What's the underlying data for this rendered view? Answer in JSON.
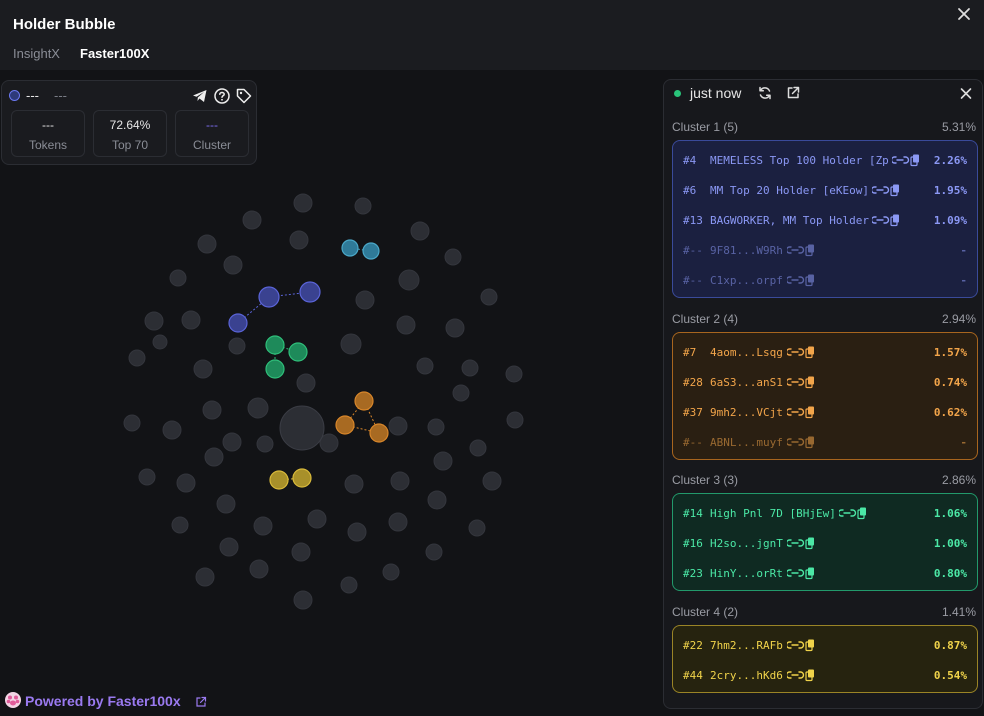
{
  "header": {
    "title": "Holder Bubble",
    "tabs": [
      {
        "label": "InsightX"
      },
      {
        "label": "Faster100X"
      }
    ]
  },
  "info_card": {
    "name": "---",
    "address": "---",
    "stats": [
      {
        "value": "---",
        "label": "Tokens"
      },
      {
        "value": "72.64%",
        "label": "Top 70"
      },
      {
        "value": "---",
        "label": "Cluster"
      }
    ],
    "icons": [
      "telegram-icon",
      "help-icon",
      "tag-icon"
    ]
  },
  "panel": {
    "updated": "just now",
    "icons": [
      "refresh-icon",
      "external-link-icon",
      "close-icon"
    ],
    "clusters": [
      {
        "name": "Cluster 1 (5)",
        "pct": "5.31%",
        "color": "#3a4a9a",
        "rows": [
          {
            "rank": "#4",
            "label": "MEMELESS Top 100 Holder [Zp",
            "value": "2.26%"
          },
          {
            "rank": "#6",
            "label": "MM Top 20 Holder [eKEow]",
            "value": "1.95%"
          },
          {
            "rank": "#13",
            "label": "BAGWORKER, MM Top Holder",
            "value": "1.09%"
          },
          {
            "rank": "#--",
            "label": "9F81...W9Rh",
            "value": "-"
          },
          {
            "rank": "#--",
            "label": "C1xp...orpf",
            "value": "-"
          }
        ]
      },
      {
        "name": "Cluster 2 (4)",
        "pct": "2.94%",
        "color": "#a8651e",
        "rows": [
          {
            "rank": "#7",
            "label": "4aom...Lsqg",
            "value": "1.57%"
          },
          {
            "rank": "#28",
            "label": "6aS3...anS1",
            "value": "0.74%"
          },
          {
            "rank": "#37",
            "label": "9mh2...VCjt",
            "value": "0.62%"
          },
          {
            "rank": "#--",
            "label": "ABNL...muyf",
            "value": "-"
          }
        ]
      },
      {
        "name": "Cluster 3 (3)",
        "pct": "2.86%",
        "color": "#22996b",
        "rows": [
          {
            "rank": "#14",
            "label": "High Pnl 7D [BHjEw]",
            "value": "1.06%"
          },
          {
            "rank": "#16",
            "label": "H2so...jgnT",
            "value": "1.00%"
          },
          {
            "rank": "#23",
            "label": "HinY...orRt",
            "value": "0.80%"
          }
        ]
      },
      {
        "name": "Cluster 4 (2)",
        "pct": "1.41%",
        "color": "#9a8426",
        "rows": [
          {
            "rank": "#22",
            "label": "7hm2...RAFb",
            "value": "0.87%"
          },
          {
            "rank": "#44",
            "label": "2cry...hKd6",
            "value": "0.54%"
          }
        ]
      }
    ]
  },
  "footer": {
    "prefix": "Powered by ",
    "brand": "Faster100x"
  },
  "colors": {
    "accent_purple": "#9a7af0",
    "cluster_blue": "#5a64d8",
    "cluster_green": "#2fbf7a",
    "cluster_orange": "#d8862a",
    "cluster_yellow": "#d8b93a",
    "cluster_teal": "#4aa8c8",
    "bubble_gray": "#2c2e34"
  }
}
